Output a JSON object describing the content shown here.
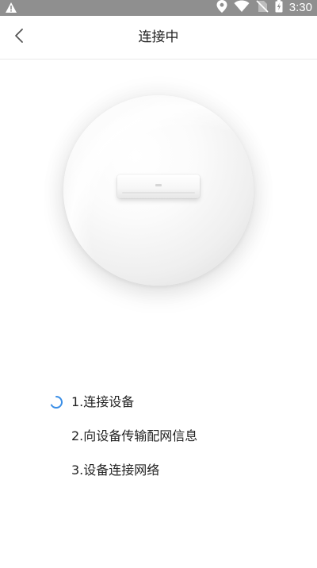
{
  "status_bar": {
    "time": "3:30",
    "icons": [
      "warning-icon",
      "location-icon",
      "wifi-icon",
      "no-sim-icon",
      "battery-charging-icon"
    ]
  },
  "header": {
    "title": "连接中",
    "back_icon": "chevron-left-icon"
  },
  "illustration": {
    "subject": "air-conditioner-unit"
  },
  "steps": [
    {
      "label": "1.连接设备",
      "state": "in-progress"
    },
    {
      "label": "2.向设备传输配网信息",
      "state": "pending"
    },
    {
      "label": "3.设备连接网络",
      "state": "pending"
    }
  ],
  "colors": {
    "status_bar_bg": "#8f8f8f",
    "spinner_accent": "#3a8ee6",
    "text": "#222222",
    "divider": "#e9e9e9"
  }
}
